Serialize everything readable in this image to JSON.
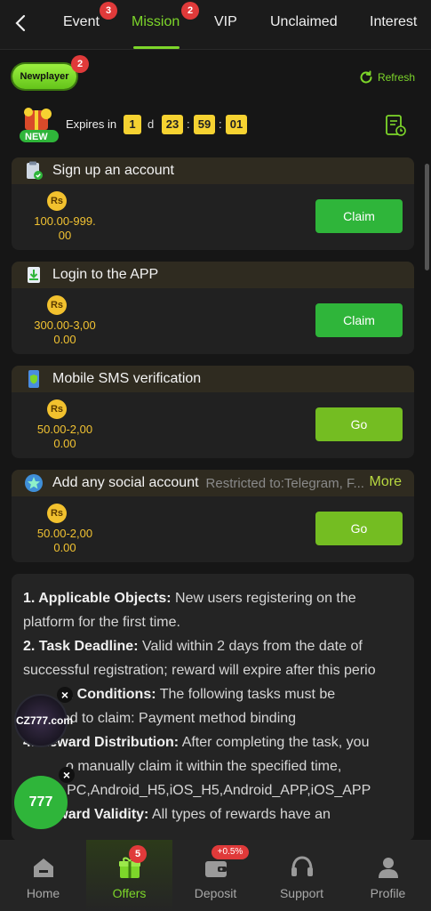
{
  "tabs": [
    {
      "label": "Event",
      "badge": "3"
    },
    {
      "label": "Mission",
      "badge": "2",
      "active": true
    },
    {
      "label": "VIP"
    },
    {
      "label": "Unclaimed"
    },
    {
      "label": "Interest"
    }
  ],
  "newplayer": {
    "label": "Newplayer",
    "badge": "2"
  },
  "refresh_label": "Refresh",
  "gift_new_label": "NEW",
  "expires": {
    "label": "Expires in",
    "days": "1",
    "d": "d",
    "hours": "23",
    "minutes": "59",
    "seconds": "01"
  },
  "tasks": [
    {
      "title": "Sign up an account",
      "coin": "Rs",
      "amount_line1": "100.00-999.",
      "amount_line2": "00",
      "button": "Claim",
      "icon": "clipboard-check-icon"
    },
    {
      "title": "Login to the APP",
      "coin": "Rs",
      "amount_line1": "300.00-3,00",
      "amount_line2": "0.00",
      "button": "Claim",
      "icon": "app-download-icon"
    },
    {
      "title": "Mobile SMS verification",
      "coin": "Rs",
      "amount_line1": "50.00-2,00",
      "amount_line2": "0.00",
      "button": "Go",
      "icon": "phone-shield-icon"
    },
    {
      "title": "Add any social account",
      "extra": "Restricted to:Telegram, F...",
      "more": "More",
      "coin": "Rs",
      "amount_line1": "50.00-2,00",
      "amount_line2": "0.00",
      "button": "Go",
      "icon": "social-star-icon"
    }
  ],
  "rules": [
    {
      "head": "1. Applicable Objects:",
      "text": " New users registering on the platform for the first time."
    },
    {
      "head": "2. Task Deadline:",
      "text": " Valid within 2 days from the date of successful registration; reward will expire after this perio"
    },
    {
      "head": "m Conditions:",
      "text": " The following tasks must be"
    },
    {
      "head": "",
      "text": "pleted to claim: Payment method binding"
    },
    {
      "head": "4. Reward Distribution:",
      "text": " After completing the task, you"
    },
    {
      "head": "",
      "text": "o manually claim it within the specified time,"
    },
    {
      "head": "",
      "text": "d to PC,Android_H5,iOS_H5,Android_APP,iOS_APP"
    },
    {
      "head": "5. Reward Validity:",
      "text": " All types of rewards have an"
    }
  ],
  "floats": {
    "promo1": "CZ777.com",
    "promo2": "777",
    "close": "×"
  },
  "nav": [
    {
      "label": "Home",
      "icon": "home-icon"
    },
    {
      "label": "Offers",
      "icon": "gift-icon",
      "badge": "5",
      "active": true
    },
    {
      "label": "Deposit",
      "icon": "wallet-icon",
      "badge": "+0.5%"
    },
    {
      "label": "Support",
      "icon": "headset-icon"
    },
    {
      "label": "Profile",
      "icon": "profile-icon"
    }
  ],
  "colors": {
    "accent": "#7dd62a",
    "claim": "#2fb53a",
    "go": "#74bd22",
    "gold": "#f1c232",
    "badge": "#e03a3a"
  }
}
